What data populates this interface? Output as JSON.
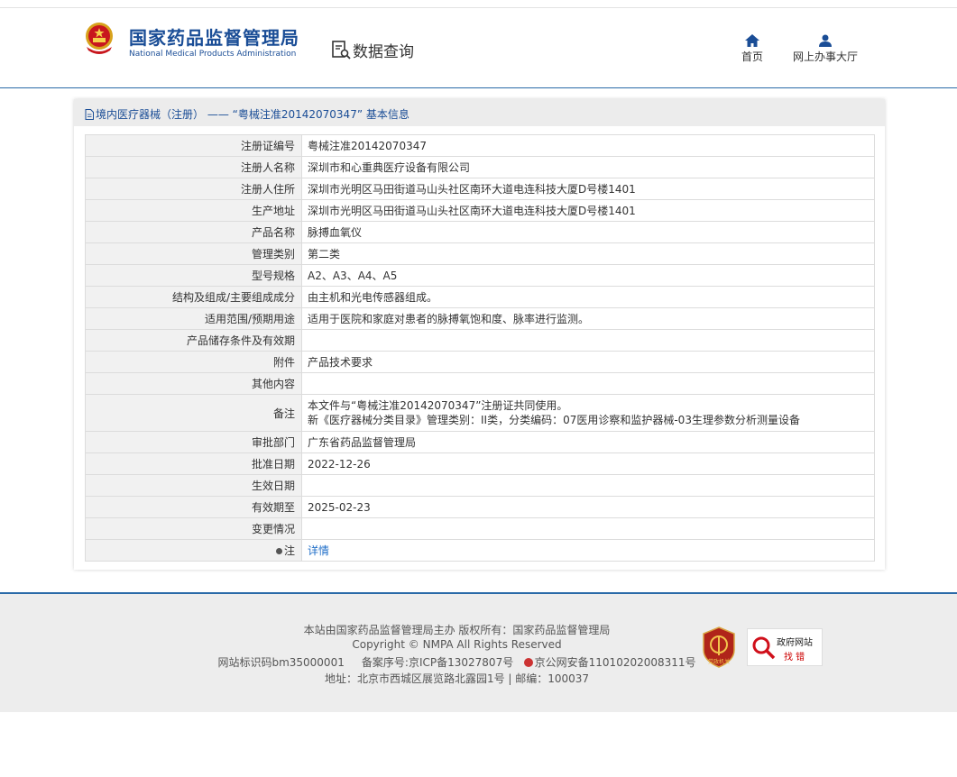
{
  "header": {
    "logo_cn": "国家药品监督管理局",
    "logo_en": "National Medical Products Administration",
    "data_query": "数据查询",
    "nav": [
      {
        "label": "首页",
        "icon": "home-icon"
      },
      {
        "label": "网上办事大厅",
        "icon": "user-icon"
      }
    ]
  },
  "panel": {
    "title": "境内医疗器械（注册） —— “粤械注准20142070347” 基本信息",
    "rows": [
      {
        "key": "注册证编号",
        "value": "粤械注准20142070347"
      },
      {
        "key": "注册人名称",
        "value": "深圳市和心重典医疗设备有限公司"
      },
      {
        "key": "注册人住所",
        "value": "深圳市光明区马田街道马山头社区南环大道电连科技大厦D号楼1401"
      },
      {
        "key": "生产地址",
        "value": "深圳市光明区马田街道马山头社区南环大道电连科技大厦D号楼1401"
      },
      {
        "key": "产品名称",
        "value": "脉搏血氧仪"
      },
      {
        "key": "管理类别",
        "value": "第二类"
      },
      {
        "key": "型号规格",
        "value": "A2、A3、A4、A5"
      },
      {
        "key": "结构及组成/主要组成成分",
        "value": "由主机和光电传感器组成。"
      },
      {
        "key": "适用范围/预期用途",
        "value": "适用于医院和家庭对患者的脉搏氧饱和度、脉率进行监测。"
      },
      {
        "key": "产品储存条件及有效期",
        "value": ""
      },
      {
        "key": "附件",
        "value": "产品技术要求"
      },
      {
        "key": "其他内容",
        "value": ""
      }
    ],
    "remark": {
      "key": "备注",
      "line1": "本文件与“粤械注准20142070347”注册证共同使用。",
      "line2": "新《医疗器械分类目录》管理类别：II类，分类编码：07医用诊察和监护器械-03生理参数分析测量设备"
    },
    "rows2": [
      {
        "key": "审批部门",
        "value": "广东省药品监督管理局"
      },
      {
        "key": "批准日期",
        "value": "2022-12-26"
      },
      {
        "key": "生效日期",
        "value": ""
      },
      {
        "key": "有效期至",
        "value": "2025-02-23"
      },
      {
        "key": "变更情况",
        "value": ""
      }
    ],
    "note": {
      "key": "注",
      "link": "详情"
    }
  },
  "footer": {
    "line1": "本站由国家药品监督管理局主办 版权所有：国家药品监督管理局",
    "line2": "Copyright © NMPA All Rights Reserved",
    "site_code": "网站标识码bm35000001",
    "icp": "备案序号:京ICP备13027807号",
    "police": "京公网安备11010202008311号",
    "line4": "地址：北京市西城区展览路北露园1号 | 邮编：100037",
    "badge_gov": "党政机关",
    "error_badge": {
      "line1": "政府网站",
      "line2": "找 错"
    }
  },
  "colors": {
    "brand_blue": "#1a4d96",
    "rule_blue": "#2a6aa8",
    "link": "#1f6ec8"
  }
}
